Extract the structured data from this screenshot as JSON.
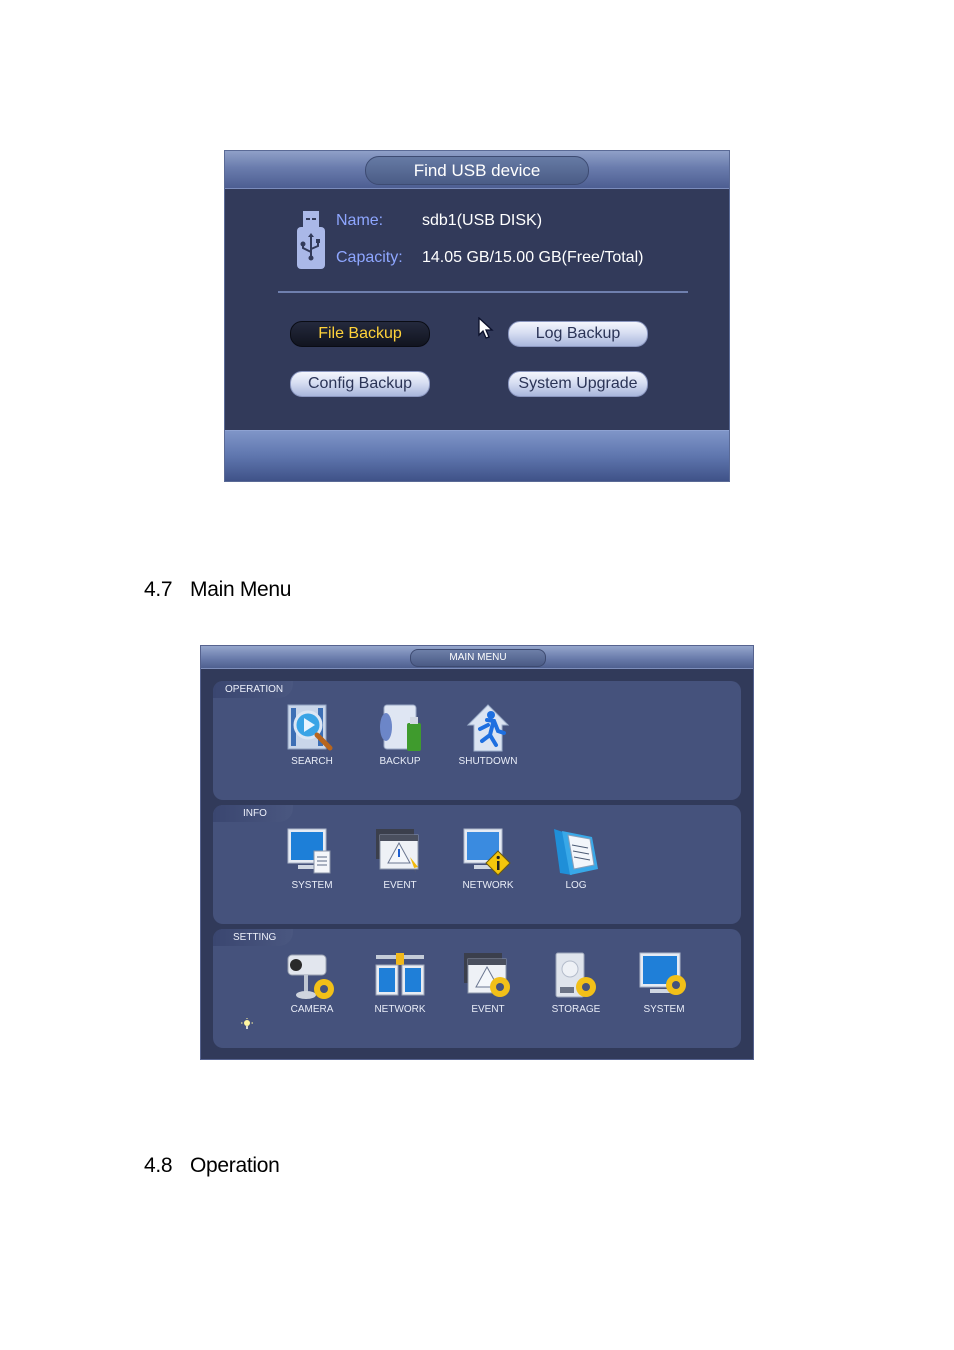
{
  "usb_dialog": {
    "title": "Find USB device",
    "name_label": "Name:",
    "name_value": "sdb1(USB DISK)",
    "capacity_label": "Capacity:",
    "capacity_value": "14.05 GB/15.00 GB(Free/Total)",
    "buttons": {
      "file_backup": "File Backup",
      "log_backup": "Log Backup",
      "config_backup": "Config Backup",
      "system_upgrade": "System Upgrade"
    },
    "selected_button": "File Backup",
    "icons": {
      "device": "usb-drive-icon",
      "pointer": "mouse-cursor-icon"
    }
  },
  "headings": [
    {
      "number": "4.7",
      "title": "Main Menu"
    },
    {
      "number": "4.8",
      "title": "Operation"
    }
  ],
  "main_menu": {
    "title": "MAIN MENU",
    "sections": [
      {
        "label": "OPERATION",
        "items": [
          {
            "label": "SEARCH",
            "icon": "search-icon"
          },
          {
            "label": "BACKUP",
            "icon": "backup-icon"
          },
          {
            "label": "SHUTDOWN",
            "icon": "shutdown-icon"
          }
        ]
      },
      {
        "label": "INFO",
        "items": [
          {
            "label": "SYSTEM",
            "icon": "system-info-icon"
          },
          {
            "label": "EVENT",
            "icon": "event-info-icon"
          },
          {
            "label": "NETWORK",
            "icon": "network-info-icon"
          },
          {
            "label": "LOG",
            "icon": "log-icon"
          }
        ]
      },
      {
        "label": "SETTING",
        "items": [
          {
            "label": "CAMERA",
            "icon": "camera-setting-icon"
          },
          {
            "label": "NETWORK",
            "icon": "network-setting-icon"
          },
          {
            "label": "EVENT",
            "icon": "event-setting-icon"
          },
          {
            "label": "STORAGE",
            "icon": "storage-setting-icon"
          },
          {
            "label": "SYSTEM",
            "icon": "system-setting-icon"
          }
        ]
      }
    ],
    "hint_icon": "lightbulb-icon"
  },
  "colors": {
    "dialog_bg": "#323a5a",
    "label_blue": "#8ea6ff",
    "selected_text": "#ffd23a",
    "section_bg": "#45527c"
  }
}
